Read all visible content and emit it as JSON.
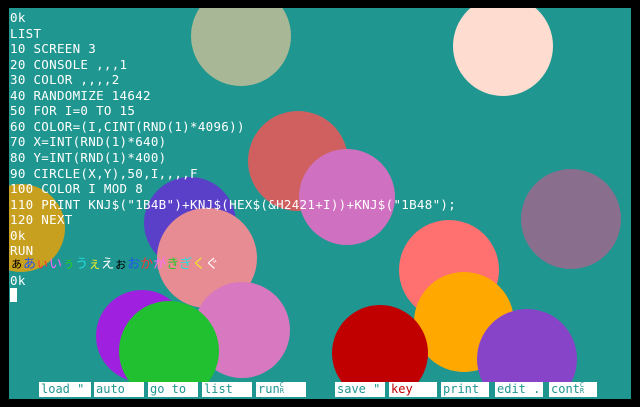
{
  "screen": {
    "background": "#1f9690",
    "border": "#000000",
    "text_color": "#ffffff"
  },
  "listing": {
    "lines": [
      "0k",
      "LIST",
      "10 SCREEN 3",
      "20 CONSOLE ,,,1",
      "30 COLOR ,,,,2",
      "40 RANDOMIZE 14642",
      "50 FOR I=0 TO 15",
      "60 COLOR=(I,CINT(RND(1)*4096))",
      "70 X=INT(RND(1)*640)",
      "80 Y=INT(RND(1)*400)",
      "90 CIRCLE(X,Y),50,I,,,,F",
      "100 COLOR I MOD 8",
      "110 PRINT KNJ$(\"1B4B\")+KNJ$(HEX$(&H2421+I))+KNJ$(\"1B48\");",
      "120 NEXT",
      "0k",
      "RUN"
    ],
    "kana_output": [
      {
        "char": "ぁ",
        "color": "#000000"
      },
      {
        "char": "あ",
        "color": "#2255ee"
      },
      {
        "char": "ぃ",
        "color": "#ff3030"
      },
      {
        "char": "い",
        "color": "#ff66ff"
      },
      {
        "char": "ぅ",
        "color": "#22cc22"
      },
      {
        "char": "う",
        "color": "#22dddd"
      },
      {
        "char": "ぇ",
        "color": "#eeee22"
      },
      {
        "char": "え",
        "color": "#ffffff"
      },
      {
        "char": "ぉ",
        "color": "#000000"
      },
      {
        "char": "お",
        "color": "#2255ee"
      },
      {
        "char": "か",
        "color": "#ff3030"
      },
      {
        "char": "が",
        "color": "#ff66ff"
      },
      {
        "char": "き",
        "color": "#22cc22"
      },
      {
        "char": "ぎ",
        "color": "#22dddd"
      },
      {
        "char": "く",
        "color": "#eeee22"
      },
      {
        "char": "ぐ",
        "color": "#ffffff"
      }
    ],
    "after_run": "0k"
  },
  "circles": [
    {
      "color": "#a8b896"
    },
    {
      "color": "#ffdcd0"
    },
    {
      "color": "#d06060"
    },
    {
      "color": "#d070c0"
    },
    {
      "color": "#5a40c8"
    },
    {
      "color": "#c8a020"
    },
    {
      "color": "#8a6e8e"
    },
    {
      "color": "#e88c94"
    },
    {
      "color": "#ff7070"
    },
    {
      "color": "#ffa800"
    },
    {
      "color": "#a020e0"
    },
    {
      "color": "#d878c0"
    },
    {
      "color": "#20c030"
    },
    {
      "color": "#c00000"
    },
    {
      "color": "#8844c8"
    }
  ],
  "function_keys": [
    {
      "label": "load \"",
      "name": "fkey-load"
    },
    {
      "label": "auto",
      "name": "fkey-auto"
    },
    {
      "label": "go to",
      "name": "fkey-goto"
    },
    {
      "label": "list",
      "name": "fkey-list"
    },
    {
      "label": "run",
      "sup": "C",
      "sub": "R",
      "name": "fkey-run"
    },
    {
      "label": "save \"",
      "name": "fkey-save"
    },
    {
      "label": "key",
      "name": "fkey-key"
    },
    {
      "label": "print",
      "name": "fkey-print"
    },
    {
      "label": "edit .",
      "name": "fkey-edit"
    },
    {
      "label": "cont",
      "sup": "C",
      "sub": "R",
      "name": "fkey-cont"
    }
  ]
}
